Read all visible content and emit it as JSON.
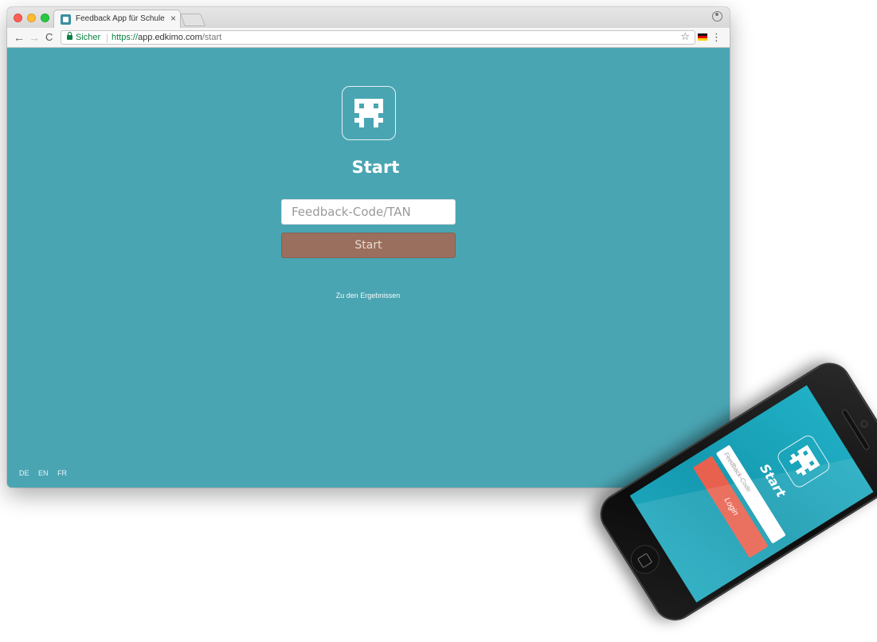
{
  "browser": {
    "tab": {
      "title": "Feedback App für Schule und",
      "close": "×"
    },
    "toolbar": {
      "back": "←",
      "forward": "→",
      "reload": "C",
      "secure_label": "Sicher",
      "url_scheme": "https://",
      "url_host": "app.edkimo.com",
      "url_path": "/start",
      "star": "☆",
      "menu": "⋮"
    }
  },
  "page": {
    "title": "Start",
    "input_placeholder": "Feedback-Code/TAN",
    "start_button": "Start",
    "results_link": "Zu den Ergebnissen",
    "languages": [
      "DE",
      "EN",
      "FR"
    ],
    "background_color": "#4aa5b3",
    "button_color": "#9a6f5e"
  },
  "phone": {
    "title": "Start",
    "input_placeholder": "Feedback-Code",
    "login_button": "Login",
    "login_color": "#e8614f"
  }
}
